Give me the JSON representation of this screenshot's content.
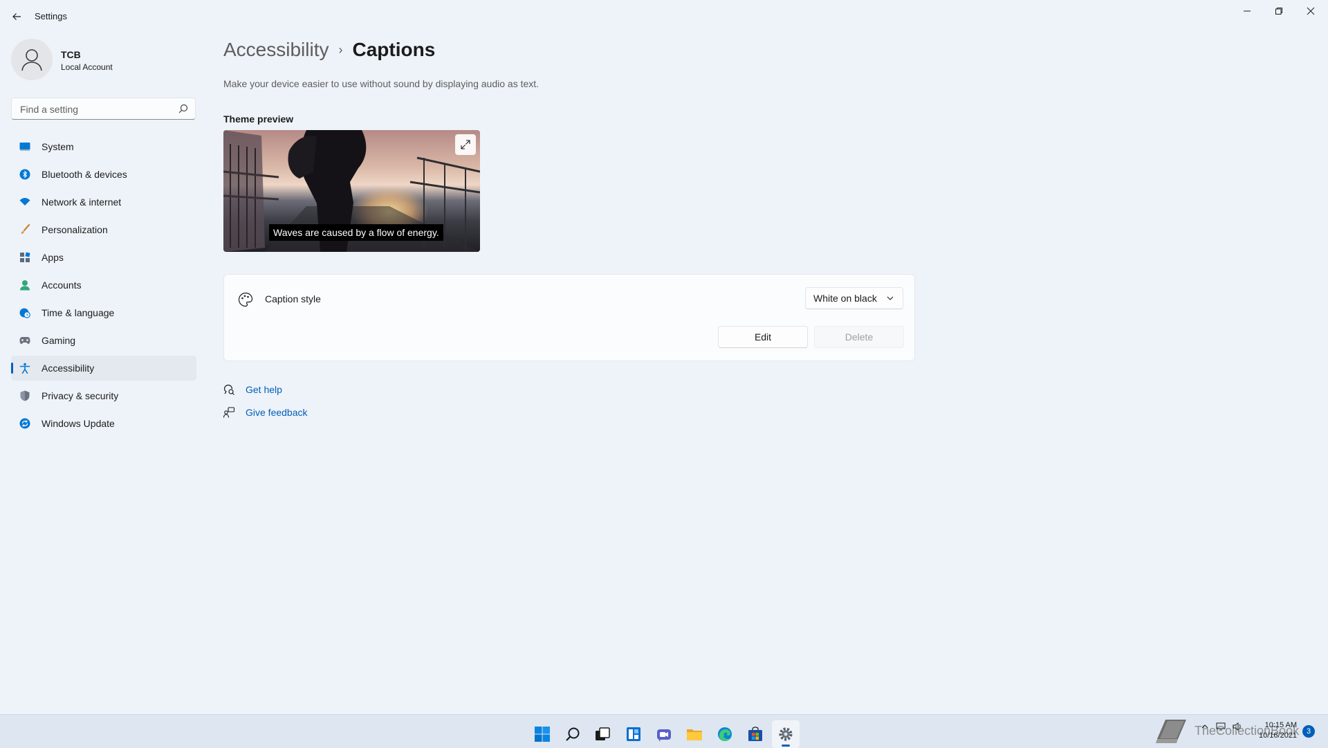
{
  "window": {
    "title": "Settings"
  },
  "user": {
    "name": "TCB",
    "account_type": "Local Account"
  },
  "search": {
    "placeholder": "Find a setting"
  },
  "sidebar": {
    "items": [
      {
        "label": "System",
        "icon": "system-icon",
        "color": "#0078d4"
      },
      {
        "label": "Bluetooth & devices",
        "icon": "bluetooth-icon",
        "color": "#0078d4"
      },
      {
        "label": "Network & internet",
        "icon": "wifi-icon",
        "color": "#0078d4"
      },
      {
        "label": "Personalization",
        "icon": "brush-icon",
        "color": "#d08a3c"
      },
      {
        "label": "Apps",
        "icon": "apps-icon",
        "color": "#5a6b7d"
      },
      {
        "label": "Accounts",
        "icon": "person-icon",
        "color": "#2fa77a"
      },
      {
        "label": "Time & language",
        "icon": "globe-clock-icon",
        "color": "#0078d4"
      },
      {
        "label": "Gaming",
        "icon": "controller-icon",
        "color": "#6b7280"
      },
      {
        "label": "Accessibility",
        "icon": "accessibility-icon",
        "color": "#0078d4",
        "selected": true
      },
      {
        "label": "Privacy & security",
        "icon": "shield-icon",
        "color": "#6b7280"
      },
      {
        "label": "Windows Update",
        "icon": "update-icon",
        "color": "#0078d4"
      }
    ]
  },
  "main": {
    "breadcrumb_parent": "Accessibility",
    "breadcrumb_separator": "›",
    "title": "Captions",
    "description": "Make your device easier to use without sound by displaying audio as text.",
    "preview_label": "Theme preview",
    "preview_caption": "Waves are caused by a flow of energy.",
    "caption_style": {
      "label": "Caption style",
      "selected_value": "White on black",
      "edit_label": "Edit",
      "delete_label": "Delete"
    },
    "links": {
      "help": "Get help",
      "feedback": "Give feedback"
    }
  },
  "taskbar": {
    "apps": [
      "windows-start-icon",
      "search-icon",
      "task-view-icon",
      "widgets-icon",
      "chat-icon",
      "file-explorer-icon",
      "edge-icon",
      "store-icon",
      "settings-icon"
    ],
    "active_app": "settings-icon",
    "clock_time": "10:15 AM",
    "clock_date": "10/16/2021",
    "notification_count": "3",
    "watermark": "TheCollectionBook"
  },
  "colors": {
    "accent": "#005fb8",
    "background": "#eef3f9"
  }
}
